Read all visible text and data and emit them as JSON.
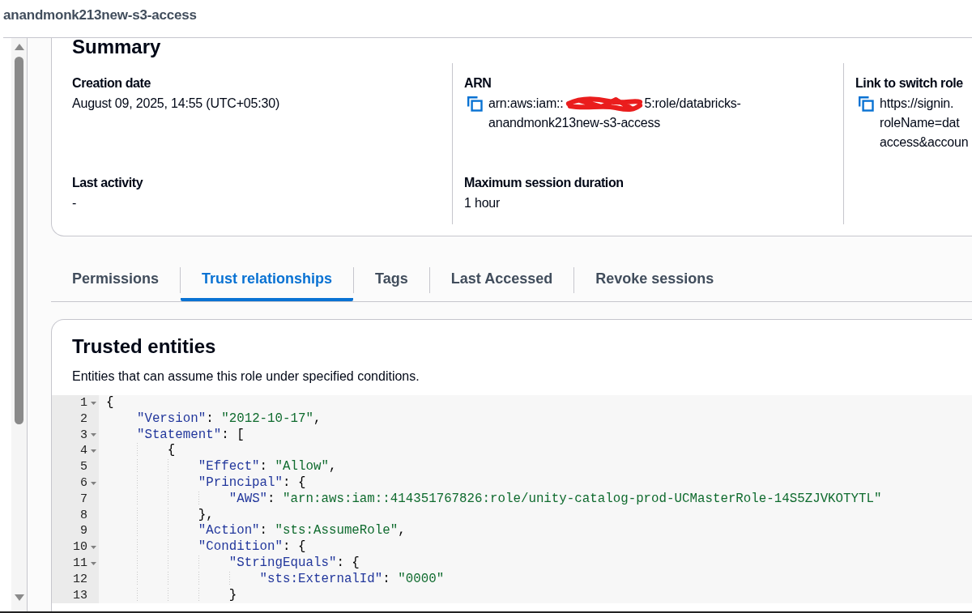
{
  "header": {
    "title": "anandmonk213new-s3-access"
  },
  "summary": {
    "title": "Summary",
    "columns": [
      {
        "fields": [
          {
            "label": "Creation date",
            "copyable": false,
            "value_lines": [
              [
                {
                  "kind": "text",
                  "text": "August 09, 2025, 14:55 (UTC+05:30)"
                }
              ]
            ]
          },
          {
            "label": "Last activity",
            "copyable": false,
            "value_lines": [
              [
                {
                  "kind": "text",
                  "text": "-"
                }
              ]
            ]
          }
        ]
      },
      {
        "fields": [
          {
            "label": "ARN",
            "copyable": true,
            "value_lines": [
              [
                {
                  "kind": "text",
                  "text": "arn:aws:iam::"
                },
                {
                  "kind": "redaction"
                },
                {
                  "kind": "text",
                  "text": "5:role/databricks-"
                }
              ],
              [
                {
                  "kind": "text",
                  "text": "anandmonk213new-s3-access"
                }
              ]
            ]
          },
          {
            "label": "Maximum session duration",
            "copyable": false,
            "value_lines": [
              [
                {
                  "kind": "text",
                  "text": "1 hour"
                }
              ]
            ]
          }
        ]
      },
      {
        "fields": [
          {
            "label": "Link to switch role",
            "copyable": true,
            "value_lines": [
              [
                {
                  "kind": "text",
                  "text": "https://signin."
                }
              ],
              [
                {
                  "kind": "text",
                  "text": "roleName=dat"
                }
              ],
              [
                {
                  "kind": "text",
                  "text": "access&accoun"
                }
              ]
            ]
          }
        ]
      }
    ]
  },
  "tabs": [
    {
      "label": "Permissions",
      "selected": false
    },
    {
      "label": "Trust relationships",
      "selected": true
    },
    {
      "label": "Tags",
      "selected": false
    },
    {
      "label": "Last Accessed",
      "selected": false
    },
    {
      "label": "Revoke sessions",
      "selected": false
    }
  ],
  "trusted_entities": {
    "title": "Trusted entities",
    "description": "Entities that can assume this role under specified conditions.",
    "editor": {
      "lines": [
        {
          "number": "1",
          "foldable": true,
          "text": "{"
        },
        {
          "number": "2",
          "foldable": false,
          "text": "    \"Version\": \"2012-10-17\","
        },
        {
          "number": "3",
          "foldable": true,
          "text": "    \"Statement\": ["
        },
        {
          "number": "4",
          "foldable": true,
          "text": "        {"
        },
        {
          "number": "5",
          "foldable": false,
          "text": "            \"Effect\": \"Allow\","
        },
        {
          "number": "6",
          "foldable": true,
          "text": "            \"Principal\": {"
        },
        {
          "number": "7",
          "foldable": false,
          "text": "                \"AWS\": \"arn:aws:iam::414351767826:role/unity-catalog-prod-UCMasterRole-14S5ZJVKOTYTL\""
        },
        {
          "number": "8",
          "foldable": false,
          "text": "            },"
        },
        {
          "number": "9",
          "foldable": false,
          "text": "            \"Action\": \"sts:AssumeRole\","
        },
        {
          "number": "10",
          "foldable": true,
          "text": "            \"Condition\": {"
        },
        {
          "number": "11",
          "foldable": true,
          "text": "                \"StringEquals\": {"
        },
        {
          "number": "12",
          "foldable": false,
          "text": "                    \"sts:ExternalId\": \"0000\""
        },
        {
          "number": "13",
          "foldable": false,
          "text": "                }"
        }
      ]
    }
  }
}
